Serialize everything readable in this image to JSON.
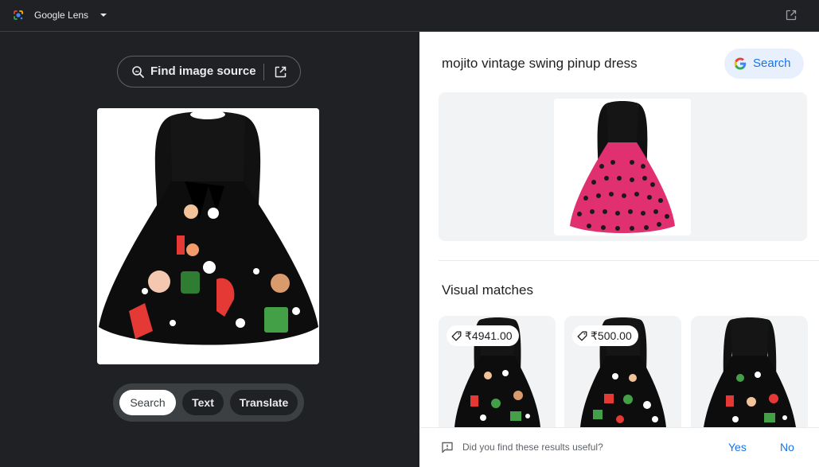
{
  "topbar": {
    "app_title": "Google Lens"
  },
  "left": {
    "find_source_label": "Find image source",
    "modes": [
      {
        "label": "Search",
        "active": true
      },
      {
        "label": "Text",
        "active": false
      },
      {
        "label": "Translate",
        "active": false
      }
    ]
  },
  "right": {
    "query": "mojito vintage swing pinup dress",
    "search_button_label": "Search",
    "section_title": "Visual matches",
    "visual_matches": [
      {
        "price": "₹4941.00"
      },
      {
        "price": "₹500.00"
      },
      {
        "price": ""
      }
    ],
    "feedback": {
      "question": "Did you find these results useful?",
      "yes": "Yes",
      "no": "No"
    }
  },
  "colors": {
    "dark_bg": "#202124",
    "accent": "#1a73e8",
    "search_pill_bg": "#e8f0fe"
  }
}
